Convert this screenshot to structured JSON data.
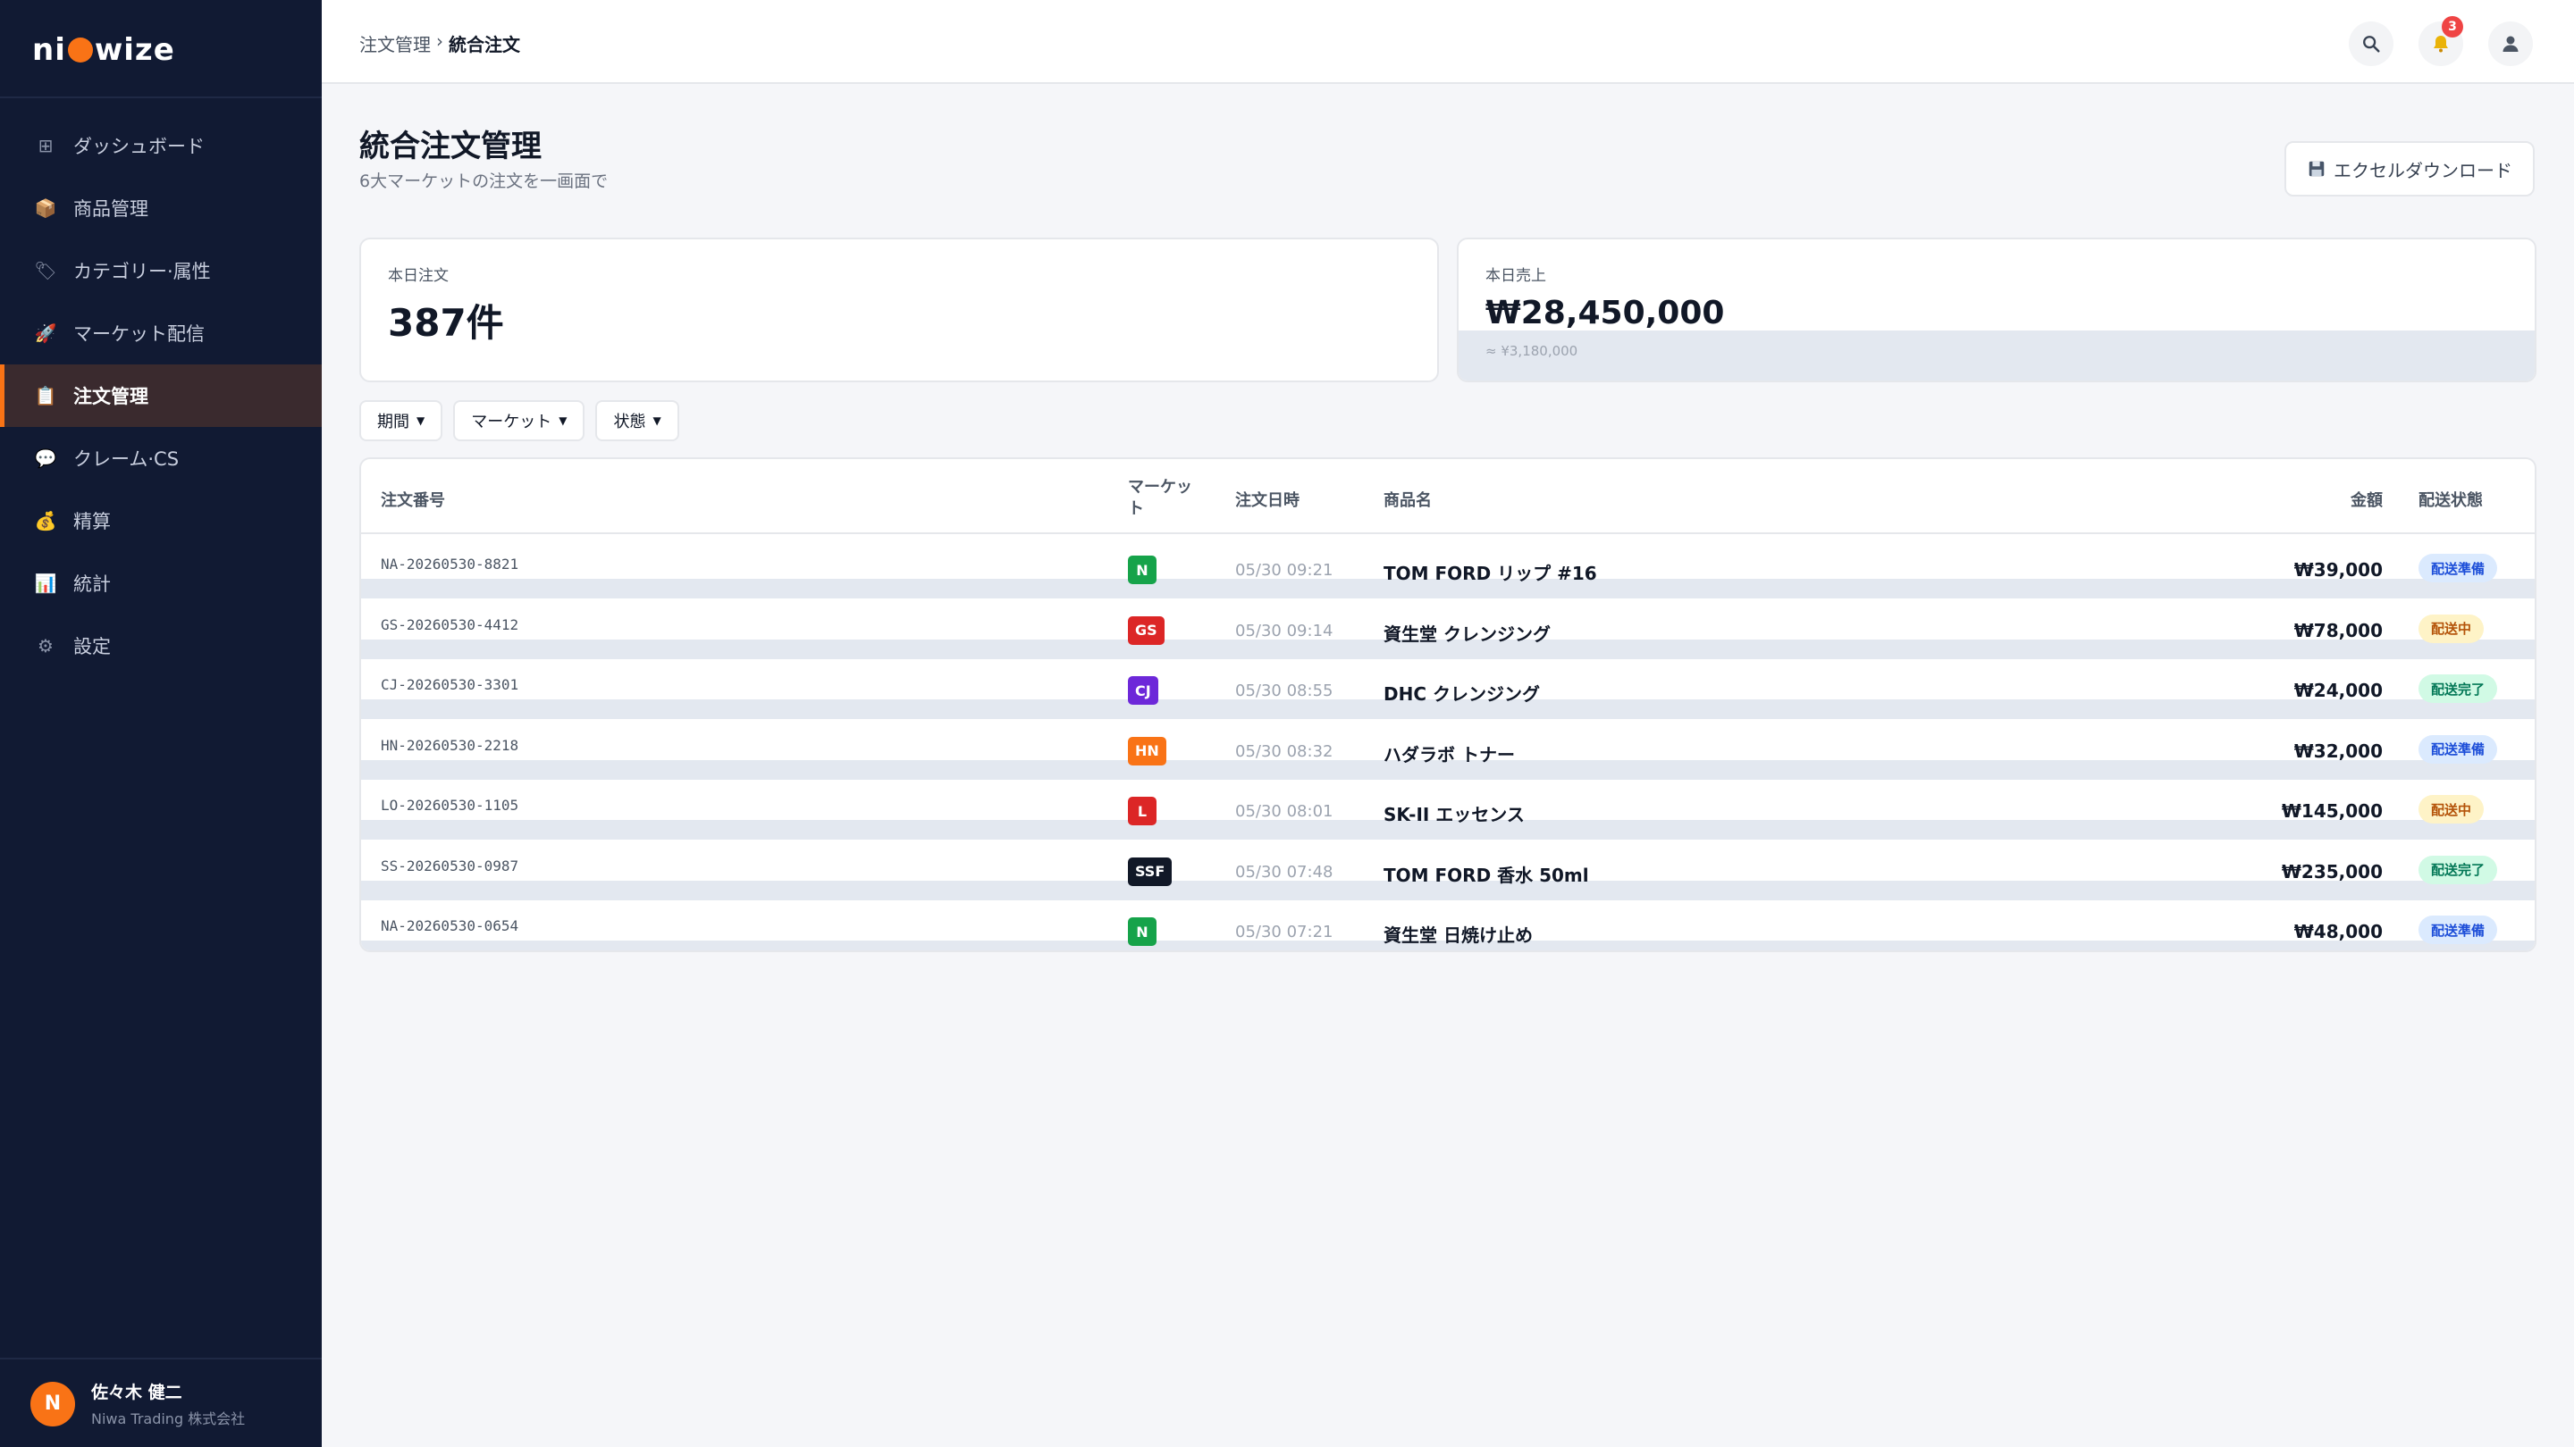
{
  "app": {
    "logo_left": "ni",
    "logo_right": "wize"
  },
  "sidebar": {
    "items": [
      {
        "label": "ダッシュボード",
        "icon": "grid-icon",
        "glyph": "⊞",
        "active": false
      },
      {
        "label": "商品管理",
        "icon": "box-icon",
        "glyph": "📦",
        "active": false
      },
      {
        "label": "カテゴリー·属性",
        "icon": "tag-icon",
        "glyph": "🏷",
        "active": false
      },
      {
        "label": "マーケット配信",
        "icon": "rocket-icon",
        "glyph": "🚀",
        "active": false
      },
      {
        "label": "注文管理",
        "icon": "clipboard-icon",
        "glyph": "📋",
        "active": true
      },
      {
        "label": "クレーム·CS",
        "icon": "chat-icon",
        "glyph": "💬",
        "active": false
      },
      {
        "label": "精算",
        "icon": "money-bag-icon",
        "glyph": "💰",
        "active": false
      },
      {
        "label": "統計",
        "icon": "chart-icon",
        "glyph": "📊",
        "active": false
      },
      {
        "label": "設定",
        "icon": "gear-icon",
        "glyph": "⚙",
        "active": false
      }
    ],
    "user": {
      "initial": "N",
      "name": "佐々木 健二",
      "company": "Niwa Trading 株式会社"
    }
  },
  "header": {
    "breadcrumb_parent": "注文管理",
    "breadcrumb_sep": "›",
    "breadcrumb_current": "統合注文",
    "notification_count": "3"
  },
  "page": {
    "title": "統合注文管理",
    "subtitle": "6大マーケットの注文を一画面で",
    "excel_button": "エクセルダウンロード"
  },
  "stats": {
    "orders_label": "本日注文",
    "orders_value": "387件",
    "sales_label": "本日売上",
    "sales_value": "₩28,450,000",
    "sales_sub": "≈ ¥3,180,000"
  },
  "filters": {
    "period": "期間",
    "market": "マーケット",
    "status": "状態"
  },
  "table": {
    "headers": {
      "order_no": "注文番号",
      "market_line1": "マーケッ",
      "market_line2": "ト",
      "date": "注文日時",
      "product": "商品名",
      "amount": "金額",
      "status": "配送状態"
    },
    "rows": [
      {
        "order_no": "NA-20260530-8821",
        "market": "N",
        "market_color": "#16a34a",
        "date": "05/30 09:21",
        "product": "TOM FORD リップ #16",
        "amount": "₩39,000",
        "status": "配送準備",
        "status_type": "prep"
      },
      {
        "order_no": "GS-20260530-4412",
        "market": "GS",
        "market_color": "#dc2626",
        "date": "05/30 09:14",
        "product": "資生堂 クレンジング",
        "amount": "₩78,000",
        "status": "配送中",
        "status_type": "ship"
      },
      {
        "order_no": "CJ-20260530-3301",
        "market": "CJ",
        "market_color": "#6d28d9",
        "date": "05/30 08:55",
        "product": "DHC クレンジング",
        "amount": "₩24,000",
        "status": "配送完了",
        "status_type": "done"
      },
      {
        "order_no": "HN-20260530-2218",
        "market": "HN",
        "market_color": "#f97316",
        "date": "05/30 08:32",
        "product": "ハダラボ トナー",
        "amount": "₩32,000",
        "status": "配送準備",
        "status_type": "prep"
      },
      {
        "order_no": "LO-20260530-1105",
        "market": "L",
        "market_color": "#dc2626",
        "date": "05/30 08:01",
        "product": "SK-II エッセンス",
        "amount": "₩145,000",
        "status": "配送中",
        "status_type": "ship"
      },
      {
        "order_no": "SS-20260530-0987",
        "market": "SSF",
        "market_color": "#111827",
        "date": "05/30 07:48",
        "product": "TOM FORD 香水 50ml",
        "amount": "₩235,000",
        "status": "配送完了",
        "status_type": "done"
      },
      {
        "order_no": "NA-20260530-0654",
        "market": "N",
        "market_color": "#16a34a",
        "date": "05/30 07:21",
        "product": "資生堂 日焼け止め",
        "amount": "₩48,000",
        "status": "配送準備",
        "status_type": "prep"
      }
    ]
  },
  "colors": {
    "accent": "#f97316",
    "sidebar_bg": "#111a33",
    "status_prep_bg": "#dbeafe",
    "status_prep_fg": "#1d4ed8",
    "status_ship_bg": "#fef3c7",
    "status_ship_fg": "#b45309",
    "status_done_bg": "#d1fae5",
    "status_done_fg": "#047857"
  }
}
